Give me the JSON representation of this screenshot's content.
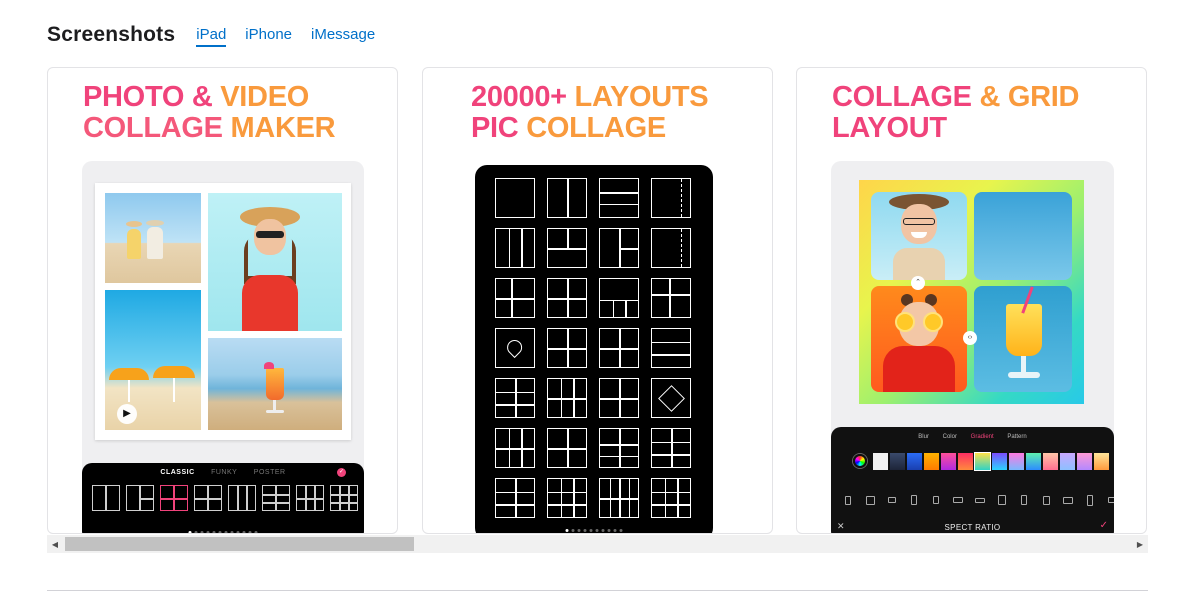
{
  "header": {
    "title": "Screenshots",
    "tabs": [
      {
        "label": "iPad",
        "active": true
      },
      {
        "label": "iPhone",
        "active": false
      },
      {
        "label": "iMessage",
        "active": false
      }
    ]
  },
  "cards": [
    {
      "line1_a": "PHOTO & ",
      "line1_b": "VIDEO",
      "line2_a": "COLLAGE ",
      "line2_b": "MAKER",
      "dock_tabs": [
        "CLASSIC",
        "FUNKY",
        "POSTER"
      ]
    },
    {
      "line1_a": "20000+ ",
      "line1_b": "LAYOUTS",
      "line2_a": "PIC ",
      "line2_b": "COLLAGE"
    },
    {
      "line1_a": "COLLAGE ",
      "line1_b": "& GRID",
      "line2_a": "LAYOUT",
      "line2_b": "",
      "dock_tabs": [
        "Blur",
        "Color",
        "Gradient",
        "Pattern"
      ],
      "aspect_label": "SPECT RATIO"
    }
  ],
  "colors": {
    "accent": "#0070c9",
    "pink": "#f0437b",
    "orange": "#f99a3d"
  },
  "icons": {
    "play": "play-icon",
    "close": "close-icon",
    "check": "check-icon",
    "left_arrow": "scroll-left-icon",
    "right_arrow": "scroll-right-icon"
  }
}
